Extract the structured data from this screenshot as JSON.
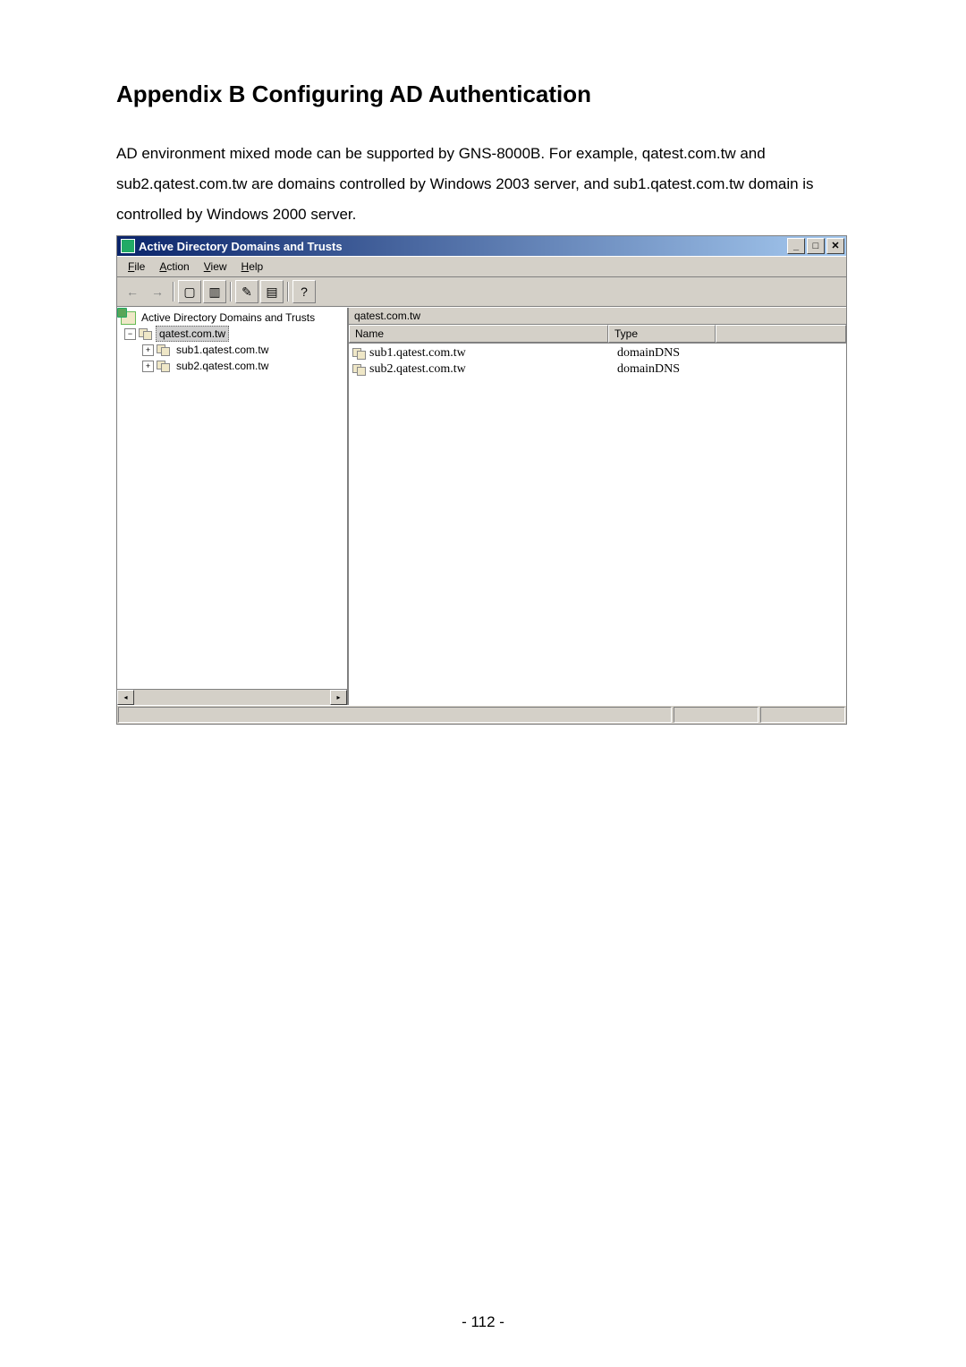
{
  "heading": "Appendix B    Configuring AD Authentication",
  "paragraph": "AD environment mixed mode can be supported by GNS-8000B.  For example, qatest.com.tw and sub2.qatest.com.tw are domains controlled by Windows 2003 server, and sub1.qatest.com.tw domain is controlled by Windows 2000 server.",
  "window": {
    "title": "Active Directory Domains and Trusts",
    "menu": {
      "file": "File",
      "action": "Action",
      "view": "View",
      "help": "Help"
    },
    "toolbarIcons": {
      "back": "←",
      "forward": "→",
      "up": "▢",
      "list": "▥",
      "properties": "✎",
      "export": "▤",
      "help": "?"
    },
    "tree": {
      "root": "Active Directory Domains and Trusts",
      "items": [
        {
          "label": "qatest.com.tw",
          "selected": true,
          "expander": "−",
          "indent": 0
        },
        {
          "label": "sub1.qatest.com.tw",
          "expander": "+",
          "indent": 1
        },
        {
          "label": "sub2.qatest.com.tw",
          "expander": "+",
          "indent": 1
        }
      ],
      "scroll_left": "◂",
      "scroll_right": "▸"
    },
    "list": {
      "title": "qatest.com.tw",
      "col_name": "Name",
      "col_type": "Type",
      "rows": [
        {
          "name": "sub1.qatest.com.tw",
          "type": "domainDNS"
        },
        {
          "name": "sub2.qatest.com.tw",
          "type": "domainDNS"
        }
      ]
    },
    "ctrl": {
      "min": "_",
      "max": "□",
      "close": "✕"
    }
  },
  "page_number": "- 112 -"
}
